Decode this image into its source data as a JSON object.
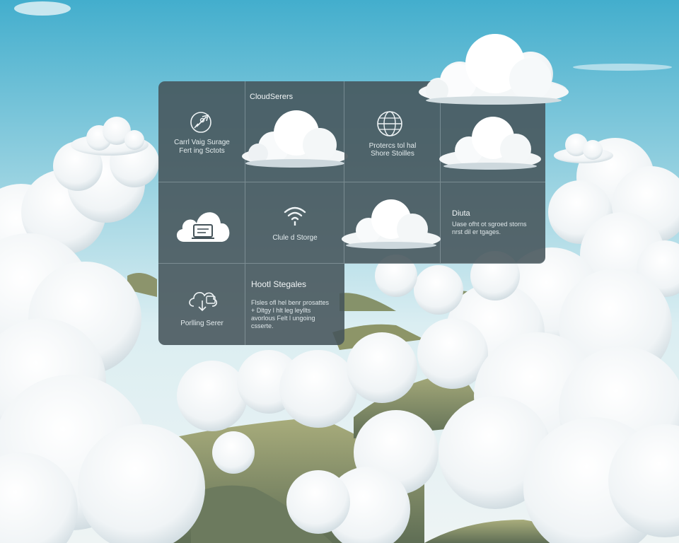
{
  "tiles": {
    "cloud_servers_title": "CloudSerers",
    "storage_label_line1": "Carrl Vaig Surage",
    "storage_label_line2": "Fert ing Sctots",
    "protects_line1": "Protercs tol hal",
    "protects_line2": "Shore Stoilles",
    "clude_storage_label": "Clule d Storge",
    "data_title": "Diuta",
    "data_line1": "Uase ofht ot sgroed storns",
    "data_line2": "nrst dil er tgages.",
    "hosting_title": "Hootl Stegales",
    "hosting_line1": "Flsles ofl hel benr prosattes",
    "hosting_line2": "+ Dltgy l hlt leg leyllts",
    "hosting_line3": "avorlous Felt l ungoing",
    "hosting_line4": "csserte.",
    "porting_label": "Porlling Serer"
  },
  "icons": {
    "rocket": "rocket-icon",
    "globe": "globe-icon",
    "cloud_laptop": "cloud-laptop-icon",
    "wifi": "wifi-icon",
    "cloud_sync": "cloud-sync-icon"
  },
  "colors": {
    "sky_top": "#4fb4d2",
    "sky_bottom": "#cfe8ee",
    "panel": "#46545a",
    "hill": "#8a9566"
  }
}
